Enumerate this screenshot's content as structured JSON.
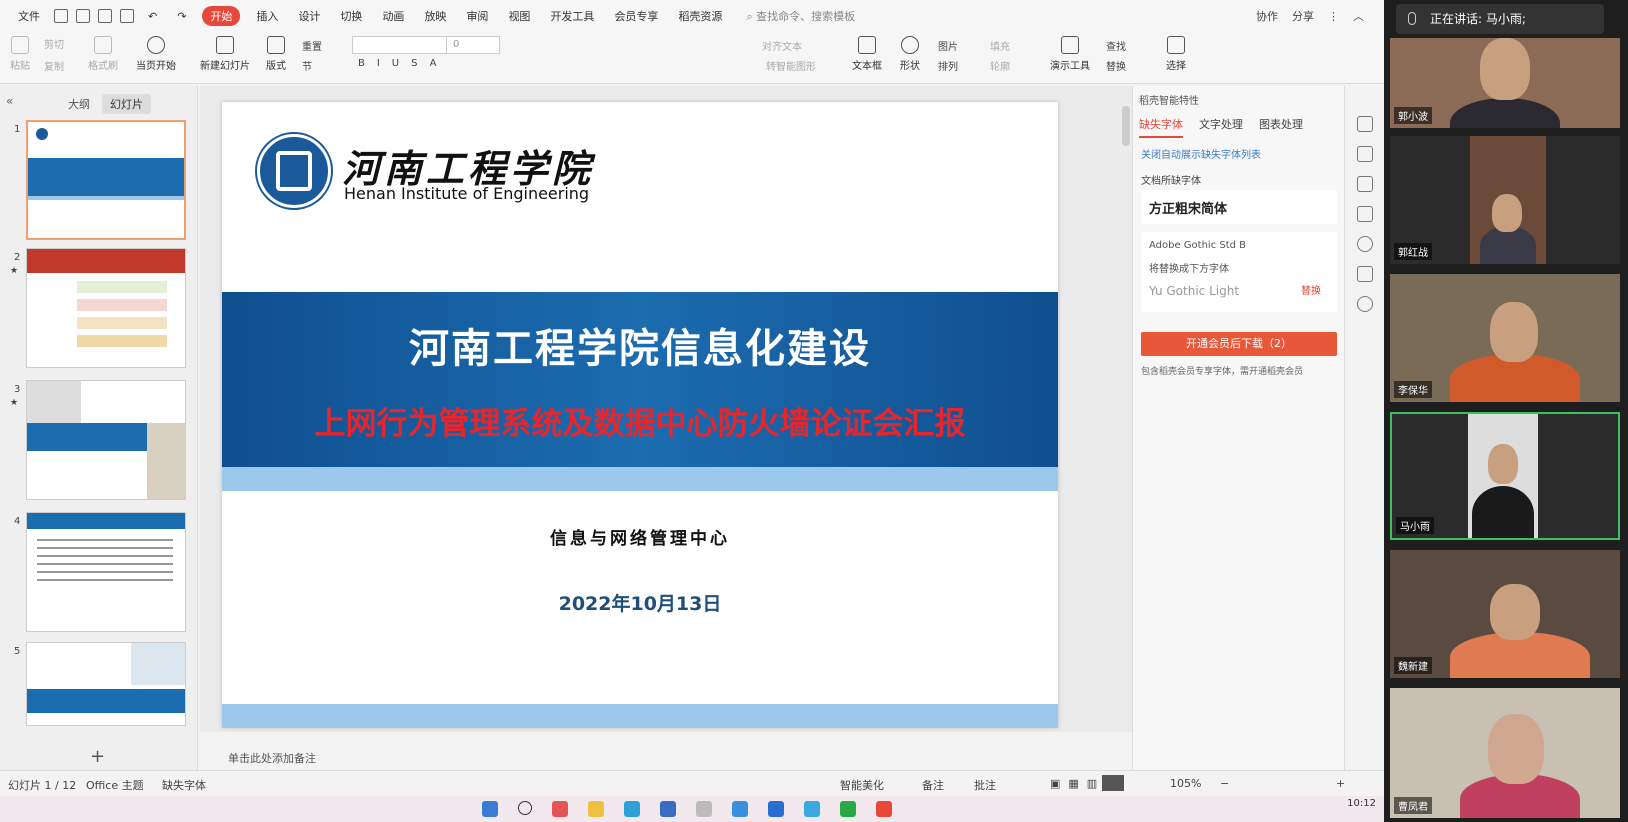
{
  "menu": {
    "file": "文件",
    "tabs": [
      "开始",
      "插入",
      "设计",
      "切换",
      "动画",
      "放映",
      "审阅",
      "视图",
      "开发工具",
      "会员专享",
      "稻壳资源"
    ],
    "search": "查找命令、搜索模板",
    "collab": "协作",
    "share": "分享"
  },
  "toolbar": {
    "paste": "粘贴",
    "cut": "剪切",
    "copy": "复制",
    "format_painter": "格式刷",
    "play_from_current": "当页开始",
    "new_slide": "新建幻灯片",
    "layout": "版式",
    "reset": "重置",
    "section": "节",
    "font_size": "0",
    "align_text": "对齐文本",
    "smart_shape": "转智能图形",
    "textbox": "文本框",
    "shape": "形状",
    "picture": "图片",
    "fill": "填充",
    "arrange": "排列",
    "outline": "轮廓",
    "present_tools": "演示工具",
    "find": "查找",
    "replace": "替换",
    "select": "选择"
  },
  "left_panel": {
    "tab_outline": "大纲",
    "tab_slides": "幻灯片",
    "slide_numbers": [
      "1",
      "2",
      "3",
      "4",
      "5"
    ]
  },
  "slide": {
    "logo_cn": "河南工程学院",
    "logo_en": "Henan Institute of Engineering",
    "title": "河南工程学院信息化建设",
    "subtitle": "上网行为管理系统及数据中心防火墙论证会汇报",
    "org": "信息与网络管理中心",
    "date": "2022年10月13日"
  },
  "notes_placeholder": "单击此处添加备注",
  "right_panel": {
    "title": "稻壳智能特性",
    "tabs": [
      "缺失字体",
      "文字处理",
      "图表处理"
    ],
    "link": "关闭自动展示缺失字体列表",
    "missing_label": "文档所缺字体",
    "font1": "方正粗宋简体",
    "font2": "Adobe Gothic Std B",
    "replace_hint": "将替换成下方字体",
    "font2_alt": "Yu Gothic Light",
    "replace_link": "替换",
    "download_btn": "开通会员后下载（2）",
    "note": "包含稻壳会员专享字体，需开通稻壳会员"
  },
  "status": {
    "slide_count": "幻灯片 1 / 12",
    "theme": "Office 主题",
    "missing_font": "缺失字体",
    "smart_beautify": "智能美化",
    "notes": "备注",
    "comment": "批注",
    "zoom": "105%"
  },
  "taskbar": {
    "time": "10:12"
  },
  "meeting": {
    "speaking_label": "正在讲话: 马小雨;",
    "participants": [
      "郭小波",
      "郭红战",
      "李保华",
      "马小雨",
      "魏新建",
      "曹凤君"
    ]
  }
}
